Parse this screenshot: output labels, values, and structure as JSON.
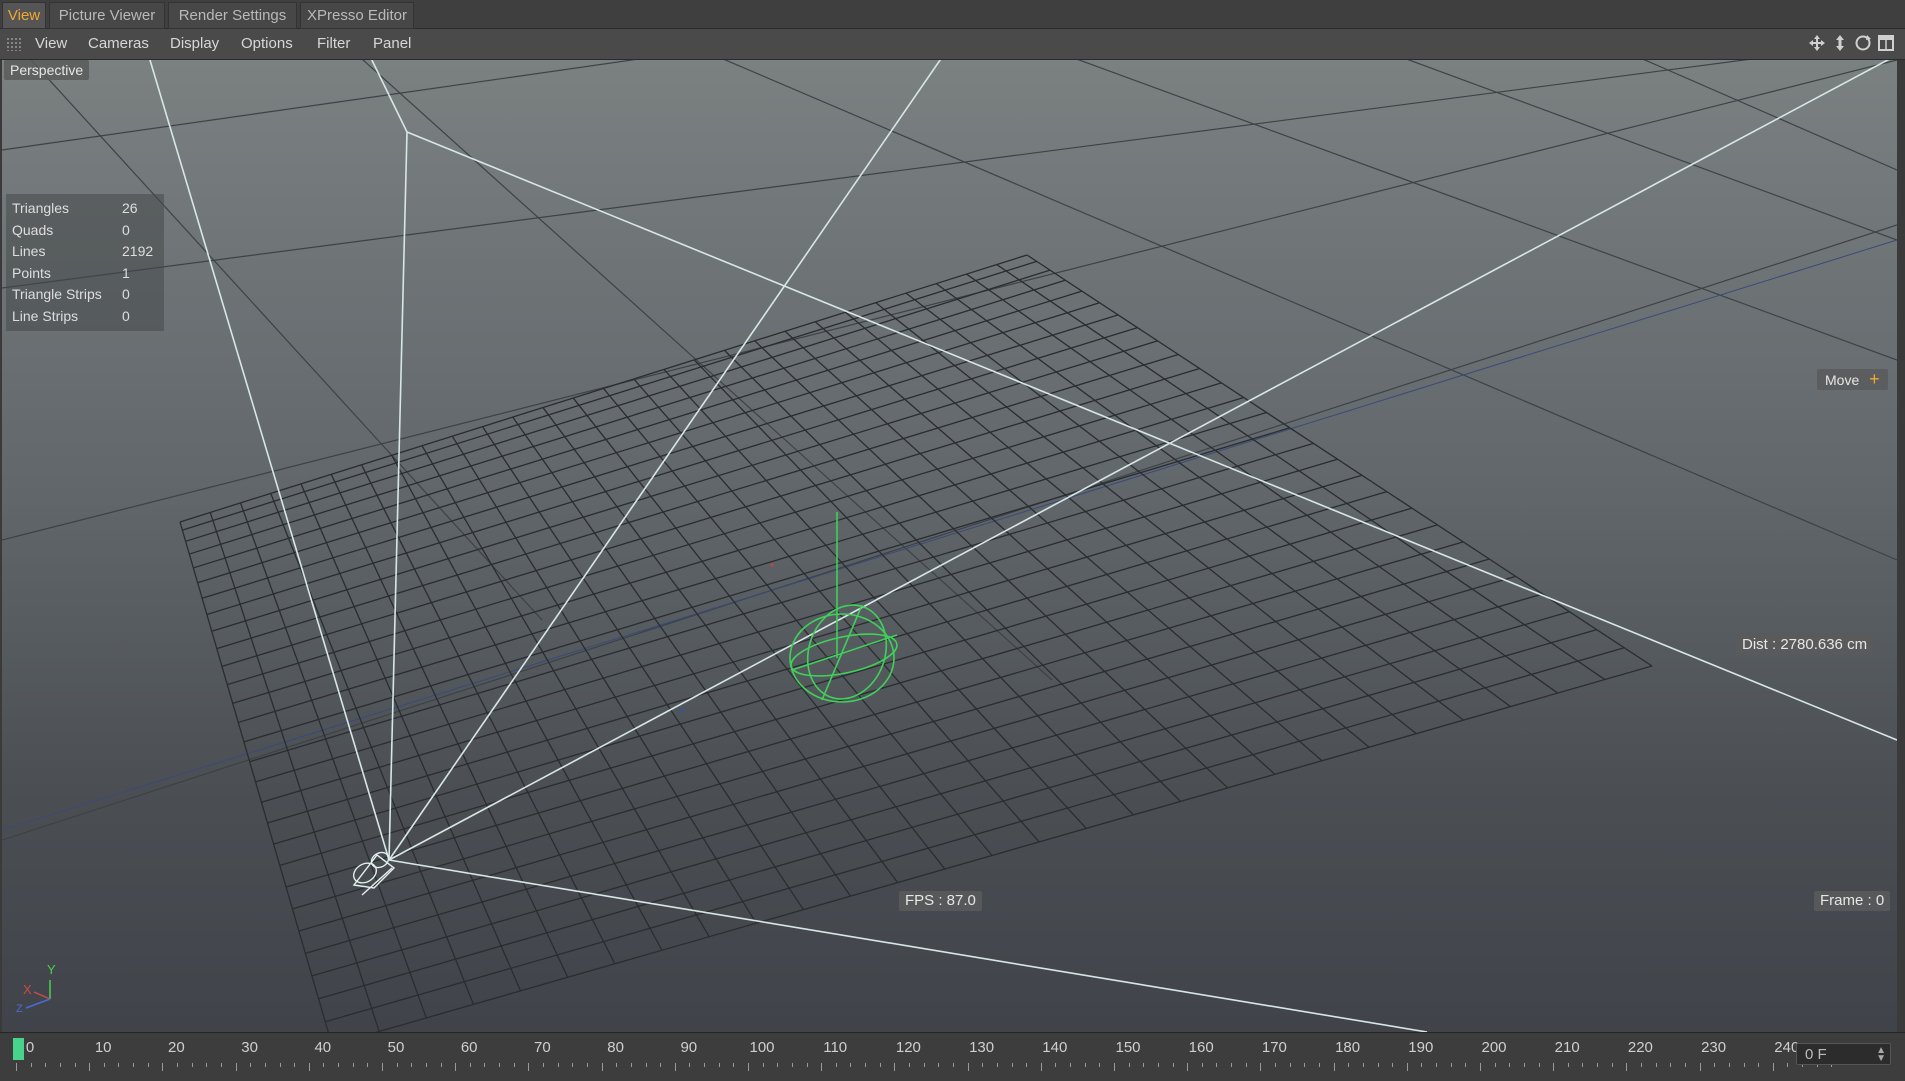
{
  "tabs": [
    {
      "label": "View",
      "active": true
    },
    {
      "label": "Picture Viewer",
      "active": false
    },
    {
      "label": "Render Settings",
      "active": false
    },
    {
      "label": "XPresso Editor",
      "active": false
    }
  ],
  "menu": [
    "View",
    "Cameras",
    "Display",
    "Options",
    "Filter",
    "Panel"
  ],
  "nav_icons": [
    "move-view-icon",
    "dolly-view-icon",
    "rotate-view-icon",
    "toggle-layout-icon"
  ],
  "viewport": {
    "name": "Perspective",
    "stats": [
      {
        "name": "Triangles",
        "value": "26"
      },
      {
        "name": "Quads",
        "value": "0"
      },
      {
        "name": "Lines",
        "value": "2192"
      },
      {
        "name": "Points",
        "value": "1"
      },
      {
        "name": "Triangle Strips",
        "value": "0"
      },
      {
        "name": "Line Strips",
        "value": "0"
      }
    ],
    "tool": "Move",
    "dist": "Dist : 2780.636 cm",
    "fps": "FPS : 87.0",
    "frame": "Frame : 0",
    "axis": {
      "x": "X",
      "y": "Y",
      "z": "Z"
    }
  },
  "timeline": {
    "ticks": [
      "0",
      "10",
      "20",
      "30",
      "40",
      "50",
      "60",
      "70",
      "80",
      "90",
      "100",
      "110",
      "120",
      "130",
      "140",
      "150",
      "160",
      "170",
      "180",
      "190",
      "200",
      "210",
      "220",
      "230",
      "240"
    ],
    "current_frame_field": "0 F"
  },
  "colors": {
    "accent": "#f0a830",
    "playhead": "#49d28a",
    "selection": "#3fd15a"
  }
}
